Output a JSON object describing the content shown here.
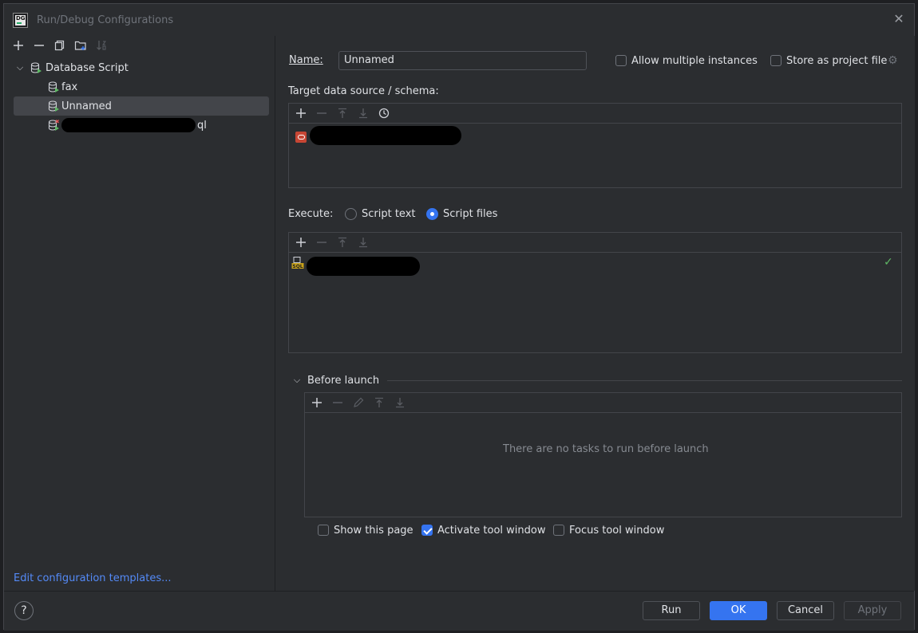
{
  "window": {
    "title": "Run/Debug Configurations",
    "logo_text": "DG"
  },
  "tree": {
    "group_label": "Database Script",
    "items": [
      {
        "label": "fax"
      },
      {
        "label": "Unnamed"
      },
      {
        "label": "ql"
      }
    ]
  },
  "left": {
    "edit_templates": "Edit configuration templates..."
  },
  "form": {
    "name_label": "Name:",
    "name_value": "Unnamed",
    "allow_multiple": "Allow multiple instances",
    "store_as_project": "Store as project file",
    "target_label": "Target data source / schema:",
    "execute_label": "Execute:",
    "script_text": "Script text",
    "script_files": "Script files",
    "before_launch": "Before launch",
    "no_tasks": "There are no tasks to run before launch",
    "show_page": "Show this page",
    "activate_tool": "Activate tool window",
    "focus_tool": "Focus tool window"
  },
  "footer": {
    "help": "?",
    "run": "Run",
    "ok": "OK",
    "cancel": "Cancel",
    "apply": "Apply"
  }
}
